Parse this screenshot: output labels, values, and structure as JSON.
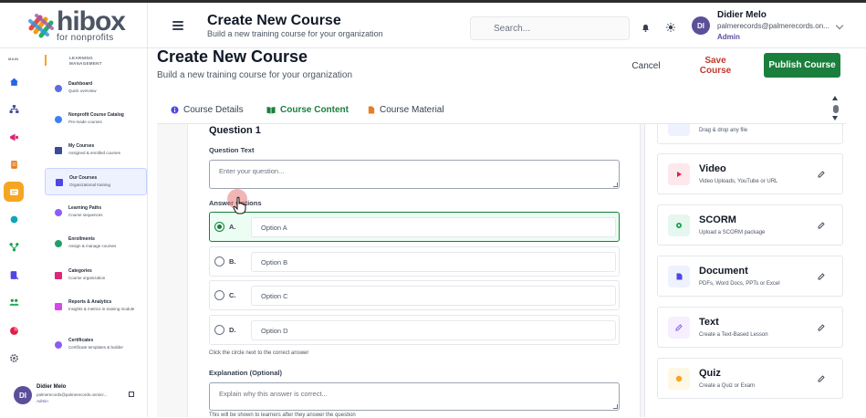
{
  "brand": {
    "name": "hibox",
    "tagline": "for nonprofits"
  },
  "header": {
    "title": "Create New Course",
    "subtitle": "Build a new training course for your organization",
    "search_placeholder": "Search...",
    "user": {
      "initials": "DI",
      "name": "Didier Melo",
      "email": "palmerecords@palmerecords.on...",
      "role": "Admin"
    }
  },
  "sidebar": {
    "rail_label": "MAIN",
    "section_label": "LEARNING MANAGEMENT",
    "rail_icons": [
      "home-icon",
      "hierarchy-icon",
      "megaphone-icon",
      "document-icon",
      "courses-icon",
      "circle-icon",
      "flow-icon",
      "form-icon",
      "team-icon",
      "pie-chart-icon",
      "settings-icon"
    ],
    "items": [
      {
        "label": "Dashboard",
        "desc": "Quick overview",
        "color": "#5b6ee1"
      },
      {
        "label": "Nonprofit Course Catalog",
        "desc": "Pre-made courses",
        "color": "#3b82f6"
      },
      {
        "label": "My Courses",
        "desc": "Assigned & enrolled courses",
        "color": "#3b4b9a"
      },
      {
        "label": "Our Courses",
        "desc": "Organizational training",
        "color": "#4f46e5"
      },
      {
        "label": "Learning Paths",
        "desc": "Course sequences",
        "color": "#8b5cf6"
      },
      {
        "label": "Enrollments",
        "desc": "Assign & manage courses",
        "color": "#22a06b"
      },
      {
        "label": "Categories",
        "desc": "Course organization",
        "color": "#db2777"
      },
      {
        "label": "Reports & Analytics",
        "desc": "Insights & metrics in training module",
        "color": "#d946ef"
      },
      {
        "label": "Certificates",
        "desc": "Certificate templates & builder",
        "color": "#8b5cf6"
      }
    ],
    "user": {
      "initials": "DI",
      "name": "Didier Melo",
      "email": "palmerecords@palmerecords.onmicr...",
      "role": "Admin"
    }
  },
  "page": {
    "title": "Create New Course",
    "subtitle": "Build a new training course for your organization",
    "cancel": "Cancel",
    "save": "Save Course",
    "publish": "Publish Course",
    "tabs": [
      "Course Details",
      "Course Content",
      "Course Material"
    ]
  },
  "question": {
    "title": "Question 1",
    "text_label": "Question Text",
    "text_placeholder": "Enter your question...",
    "options_label": "Answer Options",
    "options": [
      {
        "letter": "A.",
        "placeholder": "Option A",
        "correct": true
      },
      {
        "letter": "B.",
        "placeholder": "Option B",
        "correct": false
      },
      {
        "letter": "C.",
        "placeholder": "Option C",
        "correct": false
      },
      {
        "letter": "D.",
        "placeholder": "Option D",
        "correct": false
      }
    ],
    "options_hint": "Click the circle next to the correct answer",
    "explanation_label": "Explanation (Optional)",
    "explanation_placeholder": "Explain why this answer is correct...",
    "explanation_hint": "This will be shown to learners after they answer the question"
  },
  "materials": [
    {
      "name": "",
      "desc": "Drag & drop any file",
      "icon": "upload-icon",
      "color": "#eef2ff"
    },
    {
      "name": "Video",
      "desc": "Video Uploads, YouTube or URL",
      "icon": "video-icon",
      "color": "#fde8ec"
    },
    {
      "name": "SCORM",
      "desc": "Upload a SCORM package",
      "icon": "scorm-icon",
      "color": "#e6f7ef"
    },
    {
      "name": "Document",
      "desc": "PDFs, Word Docs, PPTs or Excel",
      "icon": "document-icon",
      "color": "#eef2ff"
    },
    {
      "name": "Text",
      "desc": "Create a Text-Based Lesson",
      "icon": "text-icon",
      "color": "#f5efff"
    },
    {
      "name": "Quiz",
      "desc": "Create a Quiz or Exam",
      "icon": "quiz-icon",
      "color": "#fff7e6"
    }
  ],
  "colors": {
    "accent": "#1a7f3c",
    "save": "#c0392b",
    "highlight": "#f5a623",
    "avatar": "#5b4f9a"
  }
}
